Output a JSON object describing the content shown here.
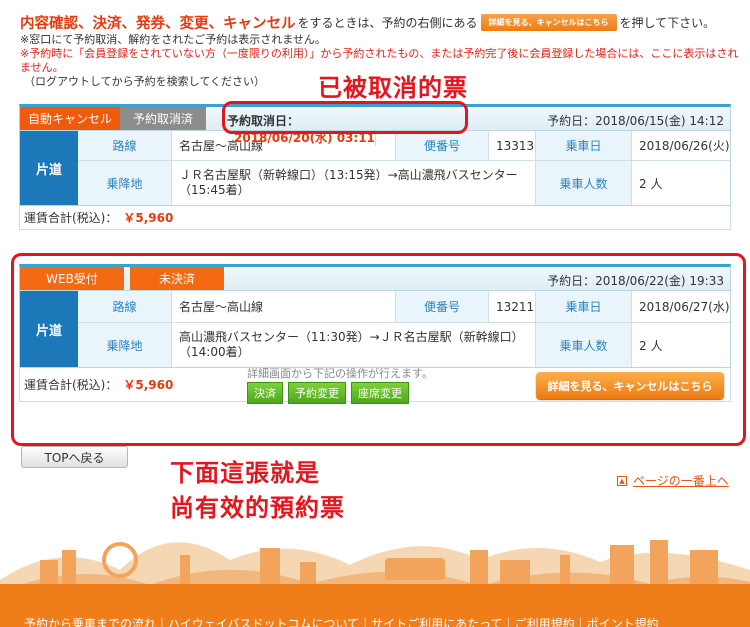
{
  "intro": {
    "title": "内容確認、決済、発券、変更、キャンセル",
    "mid_text": "をするときは、予約の右側にある",
    "mini_button": "詳細を見る、キャンセルはこちら",
    "end_text": "を押して下さい。",
    "note1": "※窓口にて予約取消、解約をされたご予約は表示されません。",
    "note2": "※予約時に「会員登録をされていない方（一度限りの利用）」から予約されたもの、または予約完了後に会員登録した場合には、ここに表示はされません。",
    "note3": "（ログアウトしてから予約を検索してください）"
  },
  "card1": {
    "tag1": "自動キャンセル",
    "tag2": "予約取消済",
    "cancel_label": "予約取消日：",
    "cancel_value": "2018/06/20(水) 03:11",
    "reserve_date": "予約日：2018/06/15(金) 14:12",
    "side": "片道",
    "route_label": "路線",
    "route_value": "名古屋～高山線",
    "bin_label": "便番号",
    "bin_value": "13313",
    "date_label": "乗車日",
    "date_value": "2018/06/26(火)",
    "stop_label": "乗降地",
    "stop_value": "ＪＲ名古屋駅（新幹線口）（13:15発）→高山濃飛バスセンター（15:45着）",
    "people_label": "乗車人数",
    "people_value": "2 人",
    "fare_label": "運賃合計(税込)：",
    "fare_value": "￥5,960"
  },
  "card2": {
    "tag1": "WEB受付",
    "tag2": "未決済",
    "reserve_date": "予約日：2018/06/22(金) 19:33",
    "side": "片道",
    "route_label": "路線",
    "route_value": "名古屋～高山線",
    "bin_label": "便番号",
    "bin_value": "13211",
    "date_label": "乗車日",
    "date_value": "2018/06/27(水)",
    "stop_label": "乗降地",
    "stop_value": "高山濃飛バスセンター（11:30発）→ＪＲ名古屋駅（新幹線口）（14:00着）",
    "people_label": "乗車人数",
    "people_value": "2 人",
    "fare_label": "運賃合計(税込)：",
    "fare_value": "￥5,960",
    "ops_note": "詳細画面から下記の操作が行えます。",
    "op_pay": "決済",
    "op_change": "予約変更",
    "op_seat": "座席変更",
    "detail_button": "詳細を見る、キャンセルはこちら"
  },
  "annotations": {
    "cancelled": "已被取消的票",
    "valid_line1": "下面這張就是",
    "valid_line2": "尚有效的預約票"
  },
  "footer": {
    "top_button": "TOPへ戻る",
    "page_top": "ページの一番上へ",
    "links": "予約から乗車までの流れ｜ハイウェイバスドットコムについて｜サイトご利用にあたって｜ご利用規約｜ポイント規約"
  }
}
